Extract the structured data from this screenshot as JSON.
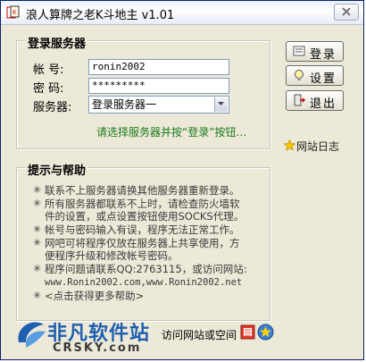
{
  "window": {
    "title": "浪人算牌之老K斗地主 v1.01",
    "close_glyph": "✕"
  },
  "login_group": {
    "title": "登录服务器",
    "account_label": "帐  号:",
    "account_value": "ronin2002",
    "password_label": "密  码:",
    "password_value": "*********",
    "server_label": "服务器:",
    "server_value": "登录服务器一",
    "hint": "请选择服务器并按“登录”按钮…"
  },
  "buttons": {
    "login": "登录",
    "settings": "设置",
    "exit": "退出"
  },
  "site_log": "网站日志",
  "help_group": {
    "title": "提示与帮助",
    "bullet_glyph": "✳",
    "items": [
      {
        "lines": [
          "联系不上服务器请换其他服务器重新登录。"
        ]
      },
      {
        "lines": [
          "所有服务器都联系不上时，请检查防火墙软",
          "件的设置，或点设置按钮使用SOCKS代理。"
        ]
      },
      {
        "lines": [
          "帐号与密码输入有误，程序无法正常工作。"
        ]
      },
      {
        "lines": [
          "网吧可将程序仅放在服务器上共享使用，方",
          "便程序升级和修改帐号密码。"
        ]
      },
      {
        "lines": [
          "程序问题请联系QQ:2763115，或访问网站:"
        ]
      },
      {
        "lines": [
          "<点击获得更多帮助>"
        ]
      }
    ],
    "url_line": "www.Ronin2002.com,www.Ronin2002.net"
  },
  "footer": {
    "visit": "访问网站或空间",
    "watermark_cn": "非凡软件站",
    "watermark_en": "CRSKY.com"
  },
  "colors": {
    "hint": "#1a7a1a",
    "background": "#ece9d8",
    "watermark_blue": "#1e5fb0"
  }
}
